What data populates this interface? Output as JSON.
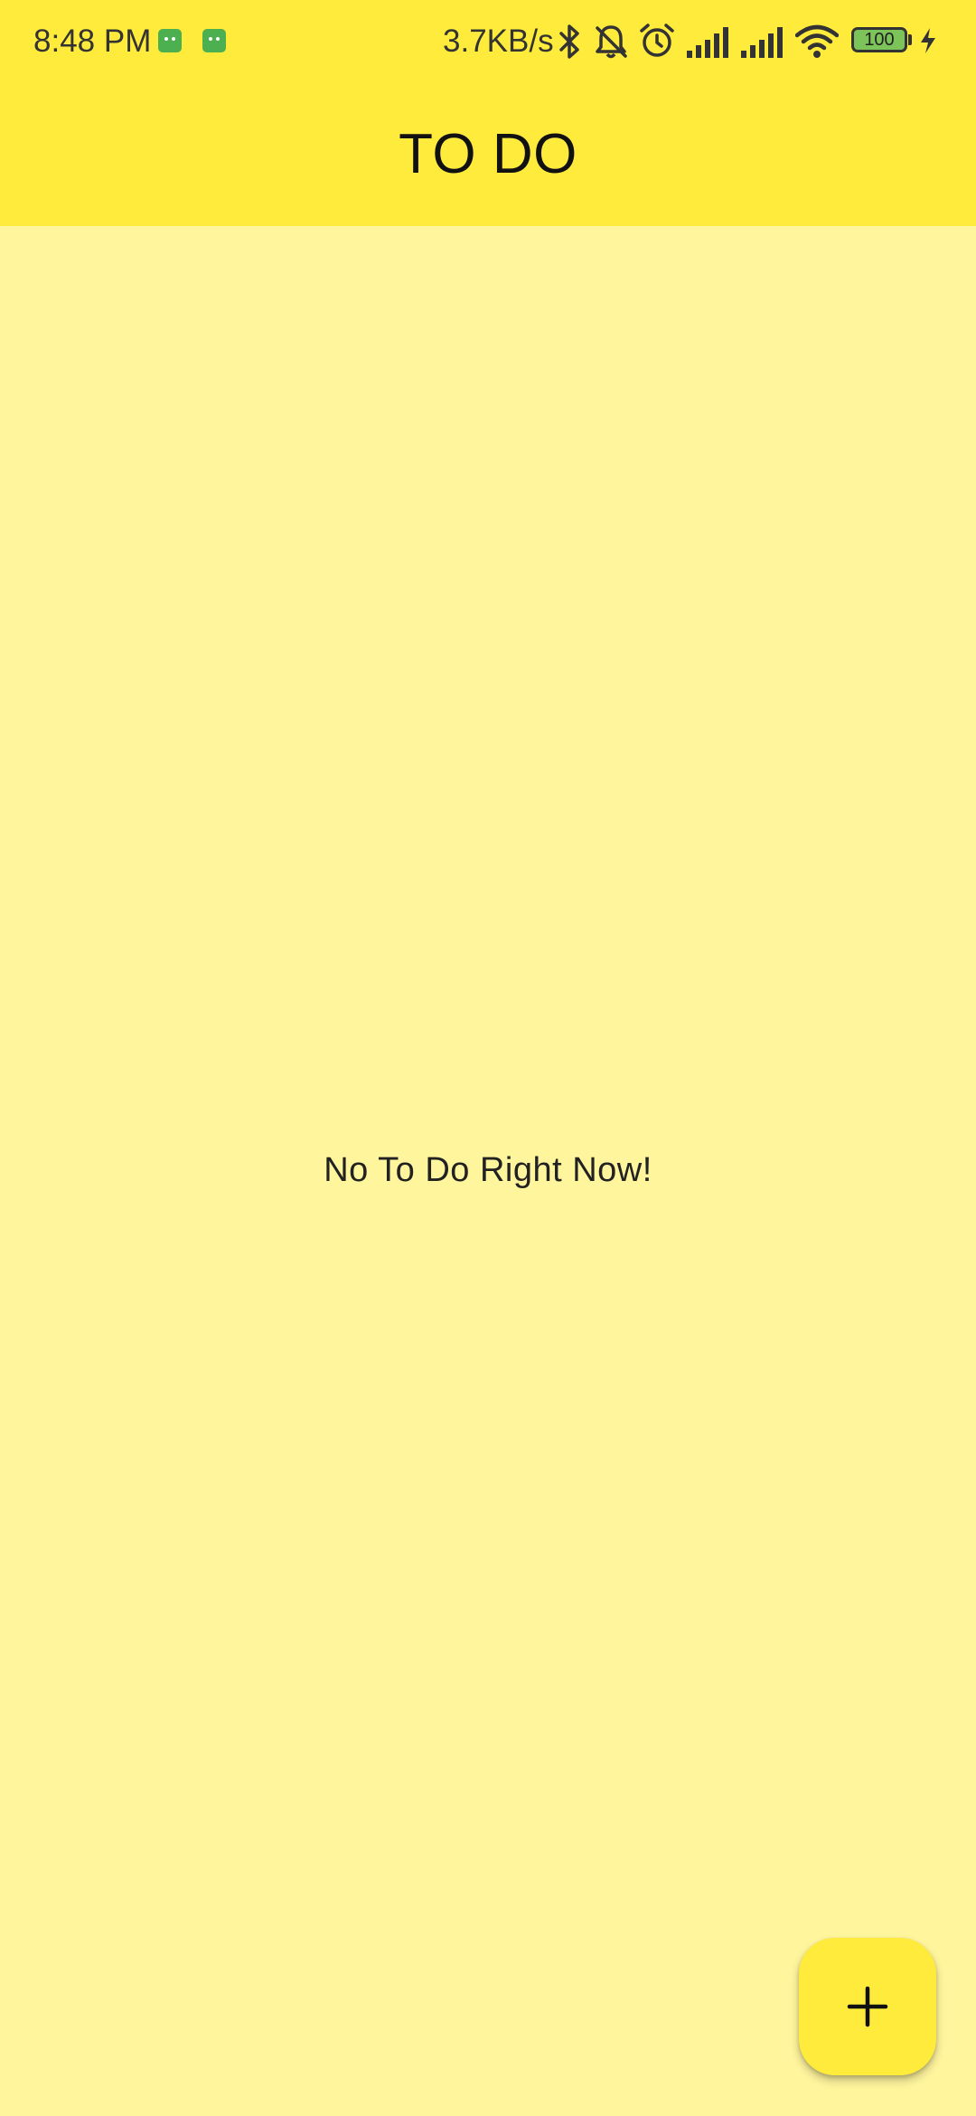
{
  "status_bar": {
    "time": "8:48 PM",
    "network_speed": "3.7KB/s",
    "battery_level": "100",
    "icons": [
      "app-notification-icon",
      "app-notification-icon",
      "bluetooth-icon",
      "bell-off-icon",
      "alarm-icon",
      "signal-icon",
      "signal-icon",
      "wifi-icon",
      "battery-icon",
      "charging-icon"
    ]
  },
  "app_bar": {
    "title": "TO DO"
  },
  "main": {
    "empty_message": "No To Do Right Now!"
  },
  "fab": {
    "icon": "plus-icon"
  },
  "colors": {
    "app_bar": "#FFEB3B",
    "background": "#FFF59D",
    "fab": "#FFEB3B",
    "text": "#111111"
  }
}
